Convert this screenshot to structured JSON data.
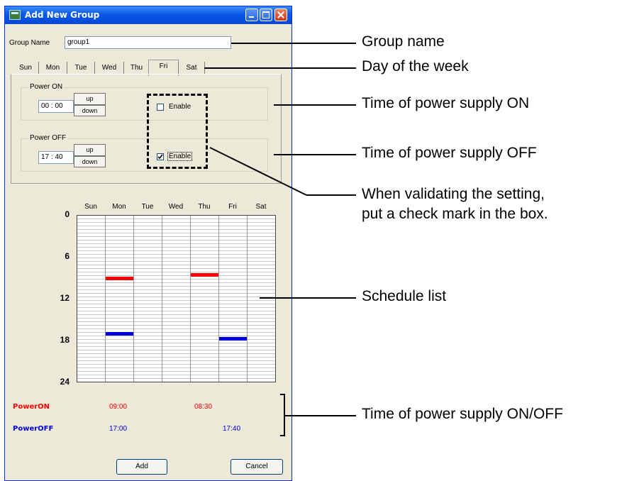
{
  "window": {
    "title": "Add New Group"
  },
  "group_name": {
    "label": "Group Name",
    "value": "group1"
  },
  "tabs": [
    {
      "label": "Sun"
    },
    {
      "label": "Mon"
    },
    {
      "label": "Tue"
    },
    {
      "label": "Wed"
    },
    {
      "label": "Thu"
    },
    {
      "label": "Fri",
      "active": true
    },
    {
      "label": "Sat"
    }
  ],
  "power_on": {
    "group_label": "Power ON",
    "time": "00 : 00",
    "up_label": "up",
    "down_label": "down",
    "enable_label": "Enable",
    "enabled": false
  },
  "power_off": {
    "group_label": "Power OFF",
    "time": "17 : 40",
    "up_label": "up",
    "down_label": "down",
    "enable_label": "Enable",
    "enabled": true
  },
  "schedule": {
    "days": [
      "Sun",
      "Mon",
      "Tue",
      "Wed",
      "Thu",
      "Fri",
      "Sat"
    ],
    "hour_ticks": [
      "0",
      "6",
      "12",
      "18",
      "24"
    ],
    "on_color": "#ff0000",
    "off_color": "#0000dd",
    "events": [
      {
        "day": "Mon",
        "type": "on",
        "hour": 9.0
      },
      {
        "day": "Thu",
        "type": "on",
        "hour": 8.5
      },
      {
        "day": "Mon",
        "type": "off",
        "hour": 17.0
      },
      {
        "day": "Fri",
        "type": "off",
        "hour": 17.67
      }
    ]
  },
  "summary": {
    "power_on_label": "PowerON",
    "power_off_label": "PowerOFF",
    "on_times": [
      {
        "day": "Mon",
        "value": "09:00"
      },
      {
        "day": "Thu",
        "value": "08:30"
      }
    ],
    "off_times": [
      {
        "day": "Mon",
        "value": "17:00"
      },
      {
        "day": "Fri",
        "value": "17:40"
      }
    ]
  },
  "buttons": {
    "add_label": "Add",
    "cancel_label": "Cancel"
  },
  "callouts": {
    "group_name": "Group name",
    "day_of_week": "Day of the week",
    "time_on": "Time of power supply ON",
    "time_off": "Time of power supply OFF",
    "validate_line1": "When validating the setting,",
    "validate_line2": "put a check mark in the box.",
    "schedule_list": "Schedule list",
    "time_on_off": "Time of power supply ON/OFF"
  }
}
